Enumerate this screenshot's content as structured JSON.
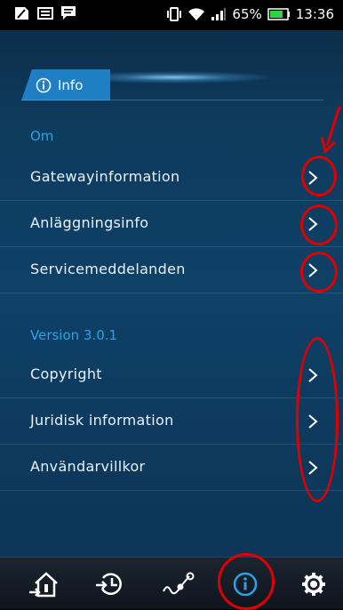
{
  "status_bar": {
    "battery_percent": "65%",
    "time": "13:36",
    "left_icons": [
      "sim-card-icon",
      "image-icon",
      "message-icon"
    ],
    "right_icons": [
      "vibrate-icon",
      "wifi-icon",
      "signal-icon",
      "battery-icon"
    ]
  },
  "tab": {
    "label": "Info",
    "icon": "info-icon"
  },
  "sections": [
    {
      "header": "Om",
      "items": [
        {
          "label": "Gatewayinformation"
        },
        {
          "label": "Anläggningsinfo"
        },
        {
          "label": "Servicemeddelanden"
        }
      ]
    },
    {
      "header": "Version 3.0.1",
      "items": [
        {
          "label": "Copyright"
        },
        {
          "label": "Juridisk information"
        },
        {
          "label": "Användarvillkor"
        }
      ]
    }
  ],
  "nav": {
    "items": [
      "home-exit-icon",
      "history-icon",
      "graph-icon",
      "info-icon",
      "settings-gear-icon"
    ],
    "active": "info-icon"
  },
  "colors": {
    "accent": "#1e7fc4",
    "section_header": "#2aa3e6",
    "annotation": "#e10000",
    "background": "#0f4066"
  }
}
